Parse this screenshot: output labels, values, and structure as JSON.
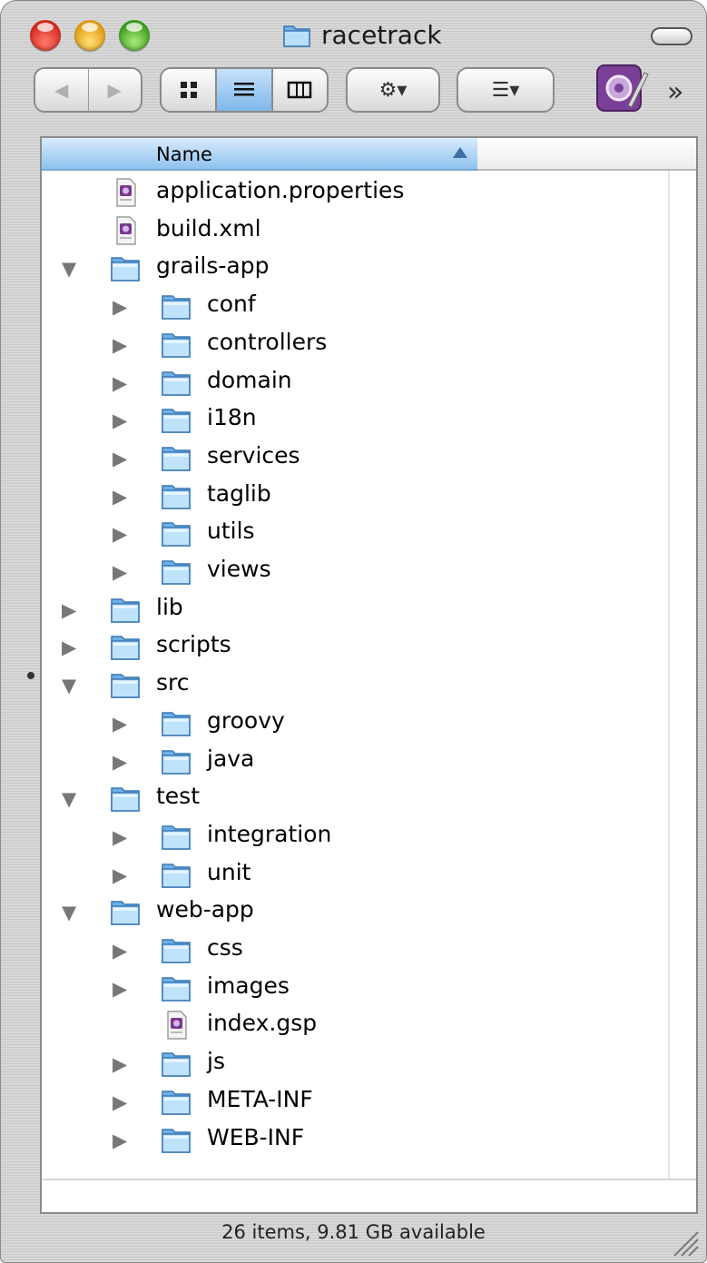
{
  "window": {
    "title": "racetrack",
    "title_icon": "folder-icon"
  },
  "toolbar": {
    "back_label": "◀",
    "forward_label": "▶",
    "view_modes": [
      "icon-view",
      "list-view",
      "column-view"
    ],
    "active_view": "list-view",
    "action_label": "⚙▾",
    "arrange_label": "☰▾",
    "overflow_label": "»"
  },
  "list": {
    "column_header": "Name",
    "sort": "ascending",
    "items": [
      {
        "name": "application.properties",
        "kind": "file",
        "depth": 0,
        "disclosure": "none"
      },
      {
        "name": "build.xml",
        "kind": "file",
        "depth": 0,
        "disclosure": "none"
      },
      {
        "name": "grails-app",
        "kind": "folder",
        "depth": 0,
        "disclosure": "expanded"
      },
      {
        "name": "conf",
        "kind": "folder",
        "depth": 1,
        "disclosure": "collapsed"
      },
      {
        "name": "controllers",
        "kind": "folder",
        "depth": 1,
        "disclosure": "collapsed"
      },
      {
        "name": "domain",
        "kind": "folder",
        "depth": 1,
        "disclosure": "collapsed"
      },
      {
        "name": "i18n",
        "kind": "folder",
        "depth": 1,
        "disclosure": "collapsed"
      },
      {
        "name": "services",
        "kind": "folder",
        "depth": 1,
        "disclosure": "collapsed"
      },
      {
        "name": "taglib",
        "kind": "folder",
        "depth": 1,
        "disclosure": "collapsed"
      },
      {
        "name": "utils",
        "kind": "folder",
        "depth": 1,
        "disclosure": "collapsed"
      },
      {
        "name": "views",
        "kind": "folder",
        "depth": 1,
        "disclosure": "collapsed"
      },
      {
        "name": "lib",
        "kind": "folder",
        "depth": 0,
        "disclosure": "collapsed"
      },
      {
        "name": "scripts",
        "kind": "folder",
        "depth": 0,
        "disclosure": "collapsed"
      },
      {
        "name": "src",
        "kind": "folder",
        "depth": 0,
        "disclosure": "expanded"
      },
      {
        "name": "groovy",
        "kind": "folder",
        "depth": 1,
        "disclosure": "collapsed"
      },
      {
        "name": "java",
        "kind": "folder",
        "depth": 1,
        "disclosure": "collapsed"
      },
      {
        "name": "test",
        "kind": "folder",
        "depth": 0,
        "disclosure": "expanded"
      },
      {
        "name": "integration",
        "kind": "folder",
        "depth": 1,
        "disclosure": "collapsed"
      },
      {
        "name": "unit",
        "kind": "folder",
        "depth": 1,
        "disclosure": "collapsed"
      },
      {
        "name": "web-app",
        "kind": "folder",
        "depth": 0,
        "disclosure": "expanded"
      },
      {
        "name": "css",
        "kind": "folder",
        "depth": 1,
        "disclosure": "collapsed"
      },
      {
        "name": "images",
        "kind": "folder",
        "depth": 1,
        "disclosure": "collapsed"
      },
      {
        "name": "index.gsp",
        "kind": "file",
        "depth": 1,
        "disclosure": "none"
      },
      {
        "name": "js",
        "kind": "folder",
        "depth": 1,
        "disclosure": "collapsed"
      },
      {
        "name": "META-INF",
        "kind": "folder",
        "depth": 1,
        "disclosure": "collapsed"
      },
      {
        "name": "WEB-INF",
        "kind": "folder",
        "depth": 1,
        "disclosure": "collapsed"
      }
    ]
  },
  "status": {
    "text": "26 items, 9.81 GB available"
  },
  "colors": {
    "header_blue": "#8fc2ef",
    "folder_blue": "#9fd0f5",
    "file_purple": "#7a3a8c"
  }
}
